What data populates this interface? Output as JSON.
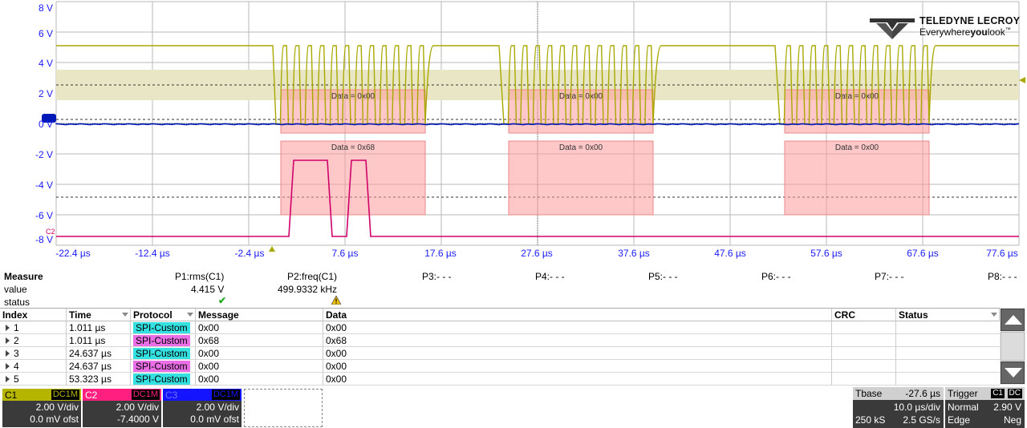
{
  "scope": {
    "y_labels": [
      "8 V",
      "6 V",
      "4 V",
      "2 V",
      "0 V",
      "-2 V",
      "-4 V",
      "-6 V",
      "-8 V"
    ],
    "x_labels": [
      "-22.4 µs",
      "-12.4 µs",
      "-2.4 µs",
      "7.6 µs",
      "17.6 µs",
      "27.6 µs",
      "37.6 µs",
      "47.6 µs",
      "57.6 µs",
      "67.6 µs",
      "77.6 µs"
    ],
    "c2_tag": "C2",
    "colors": {
      "c1": "#a8a800",
      "c2": "#d0006a",
      "c3": "#0018b8",
      "decode_fill": "#ff9a9a",
      "grid": "#b8b8b8"
    },
    "decodes_upper": [
      "Data = 0x00",
      "Data = 0x00",
      "Data = 0x00"
    ],
    "decodes_lower": [
      "Data = 0x68",
      "Data = 0x00",
      "Data = 0x00"
    ]
  },
  "logo": {
    "brand": "TELEDYNE LECROY",
    "tag_pre": "Everywhere",
    "tag_bold": "you",
    "tag_post": "look",
    "tm": "™"
  },
  "measure": {
    "row_labels": [
      "Measure",
      "value",
      "status"
    ],
    "params": [
      {
        "name": "P1:rms(C1)",
        "value": "4.415 V",
        "status": "ok"
      },
      {
        "name": "P2:freq(C1)",
        "value": "499.9332 kHz",
        "status": "warning"
      },
      {
        "name": "P3:- - -",
        "value": "",
        "status": ""
      },
      {
        "name": "P4:- - -",
        "value": "",
        "status": ""
      },
      {
        "name": "P5:- - -",
        "value": "",
        "status": ""
      },
      {
        "name": "P6:- - -",
        "value": "",
        "status": ""
      },
      {
        "name": "P7:- - -",
        "value": "",
        "status": ""
      },
      {
        "name": "P8:- - -",
        "value": "",
        "status": ""
      }
    ]
  },
  "table": {
    "headers": [
      "Index",
      "Time",
      "Protocol",
      "Message",
      "Data",
      "CRC",
      "Status"
    ],
    "rows": [
      {
        "index": "1",
        "time": "1.011 µs",
        "protocol": "SPI-Custom",
        "message": "0x00",
        "data": "0x00",
        "proto_color": "#34e0e0"
      },
      {
        "index": "2",
        "time": "1.011 µs",
        "protocol": "SPI-Custom",
        "message": "0x68",
        "data": "0x68",
        "proto_color": "#ea6ee6"
      },
      {
        "index": "3",
        "time": "24.637 µs",
        "protocol": "SPI-Custom",
        "message": "0x00",
        "data": "0x00",
        "proto_color": "#34e0e0"
      },
      {
        "index": "4",
        "time": "24.637 µs",
        "protocol": "SPI-Custom",
        "message": "0x00",
        "data": "0x00",
        "proto_color": "#ea6ee6"
      },
      {
        "index": "5",
        "time": "53.323 µs",
        "protocol": "SPI-Custom",
        "message": "0x00",
        "data": "0x00",
        "proto_color": "#34e0e0"
      }
    ]
  },
  "channels": [
    {
      "name": "C1",
      "coupling": "DC1M",
      "vdiv": "2.00 V/div",
      "offset": "0.0 mV ofst",
      "color": "#b5b500"
    },
    {
      "name": "C2",
      "coupling": "DC1M",
      "vdiv": "2.00 V/div",
      "offset": "-7.4000 V",
      "color": "#ff1f7f"
    },
    {
      "name": "C3",
      "coupling": "DC1M",
      "vdiv": "2.00 V/div",
      "offset": "0.0 mV ofst",
      "color": "#1414ff"
    }
  ],
  "timebase": {
    "label": "Tbase",
    "delay": "-27.6 µs",
    "tdiv": "10.0 µs/div",
    "samples": "250 kS",
    "rate": "2.5 GS/s"
  },
  "trigger": {
    "label": "Trigger",
    "channel": "C1",
    "coupling": "DC",
    "mode": "Normal",
    "level": "2.90 V",
    "type": "Edge",
    "slope": "Neg"
  }
}
